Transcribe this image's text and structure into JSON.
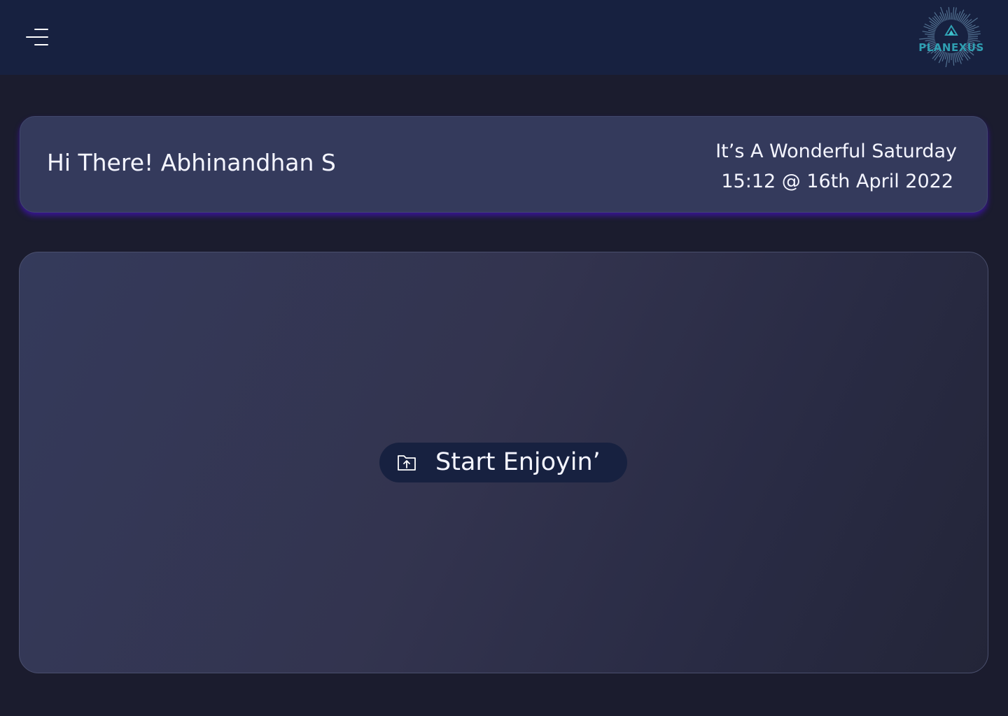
{
  "header": {
    "menu_icon": "hamburger-menu-icon",
    "logo_text": "PLANEXUS"
  },
  "greeting_card": {
    "greeting": "Hi There! Abhinandhan S",
    "day_line": "It’s A Wonderful Saturday",
    "datetime_line": "15:12 @ 16th April 2022"
  },
  "main": {
    "start_button": {
      "icon": "folder-upload-icon",
      "label": "Start Enjoyin’"
    }
  },
  "colors": {
    "background": "#1b1c2e",
    "topbar": "#172140",
    "card": "#343a5c",
    "card_glow": "#4214b4",
    "logo_accent": "#2f9fb2",
    "button": "#172140"
  }
}
